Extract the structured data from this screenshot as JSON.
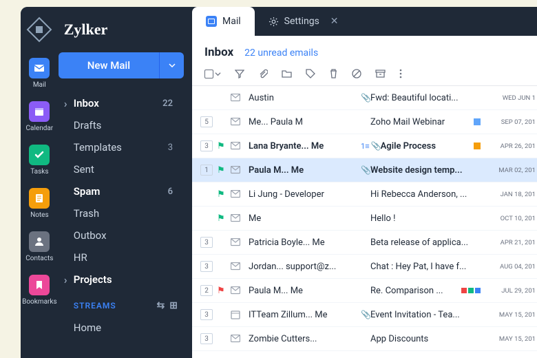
{
  "brand": "Zylker",
  "rail": {
    "items": [
      {
        "key": "mail",
        "label": "Mail"
      },
      {
        "key": "calendar",
        "label": "Calendar"
      },
      {
        "key": "tasks",
        "label": "Tasks"
      },
      {
        "key": "notes",
        "label": "Notes"
      },
      {
        "key": "contacts",
        "label": "Contacts"
      },
      {
        "key": "bookmarks",
        "label": "Bookmarks"
      }
    ]
  },
  "compose": {
    "label": "New Mail"
  },
  "folders": [
    {
      "name": "Inbox",
      "count": "22",
      "bold": true,
      "arrow": true
    },
    {
      "name": "Drafts"
    },
    {
      "name": "Templates",
      "count": "3"
    },
    {
      "name": "Sent"
    },
    {
      "name": "Spam",
      "count": "6",
      "bold": true
    },
    {
      "name": "Trash"
    },
    {
      "name": "Outbox"
    },
    {
      "name": "HR"
    },
    {
      "name": "Projects",
      "bold": true,
      "arrow": true
    }
  ],
  "streams": {
    "label": "STREAMS",
    "home": "Home"
  },
  "tabs": [
    {
      "label": "Mail",
      "active": true,
      "icon": "mail"
    },
    {
      "label": "Settings",
      "active": false,
      "icon": "gear",
      "closable": true
    }
  ],
  "header": {
    "title": "Inbox",
    "unread": "22 unread emails"
  },
  "messages": [
    {
      "thread": "",
      "flag": "",
      "from": "Austin",
      "attach": true,
      "subject": "Fwd: Beautiful locati...",
      "tag": "",
      "date": "WED JUN 1"
    },
    {
      "thread": "5",
      "flag": "",
      "from": "Me... Paula M",
      "attach": false,
      "subject": "Zoho Mail Webinar",
      "tag": "#60a5fa",
      "date": "SEP 07, 201"
    },
    {
      "thread": "3",
      "flag": "green",
      "from": "Lana Bryante... Me",
      "attach": true,
      "prefix": "1≡",
      "subject": "Agile Process",
      "tag": "#f59e0b",
      "date": "APR 26, 201",
      "unread": true
    },
    {
      "thread": "1",
      "flag": "green",
      "from": "Paula M... Me",
      "attach": true,
      "subject": "Website design temp...",
      "tag": "",
      "date": "MAR 02, 201",
      "selected": true,
      "unread": true
    },
    {
      "thread": "",
      "flag": "green",
      "from": "Li Jung - Developer",
      "attach": false,
      "subject": "Hi Rebecca Anderson, ...",
      "tag": "",
      "date": "JAN 18, 201"
    },
    {
      "thread": "",
      "flag": "green",
      "from": "Me",
      "attach": false,
      "subject": "Hello !",
      "tag": "",
      "date": "OCT 10, 201"
    },
    {
      "thread": "3",
      "flag": "",
      "from": "Patricia Boyle... Me",
      "attach": false,
      "subject": "Beta release of applica...",
      "tag": "",
      "date": "APR 21, 201"
    },
    {
      "thread": "3",
      "flag": "",
      "from": "Jordan... support@z...",
      "attach": false,
      "subject": "Chat : Hey Pat, I have f...",
      "tag": "",
      "date": "AUG 04, 201"
    },
    {
      "thread": "2",
      "flag": "red",
      "from": "Paula M... Me",
      "attach": false,
      "subject": "Re. Comparison ...",
      "tag": "multi",
      "date": "JUL 29, 201"
    },
    {
      "thread": "3",
      "flag": "",
      "from": "ITTeam Zillum... Me",
      "attach": true,
      "subject": "Event Invitation - Tea...",
      "tag": "",
      "date": "MAY 15, 201",
      "cal": true
    },
    {
      "thread": "3",
      "flag": "",
      "from": "Zombie Cutters...",
      "attach": false,
      "subject": "App Discounts",
      "tag": "",
      "date": "MAY 15, 201"
    }
  ]
}
